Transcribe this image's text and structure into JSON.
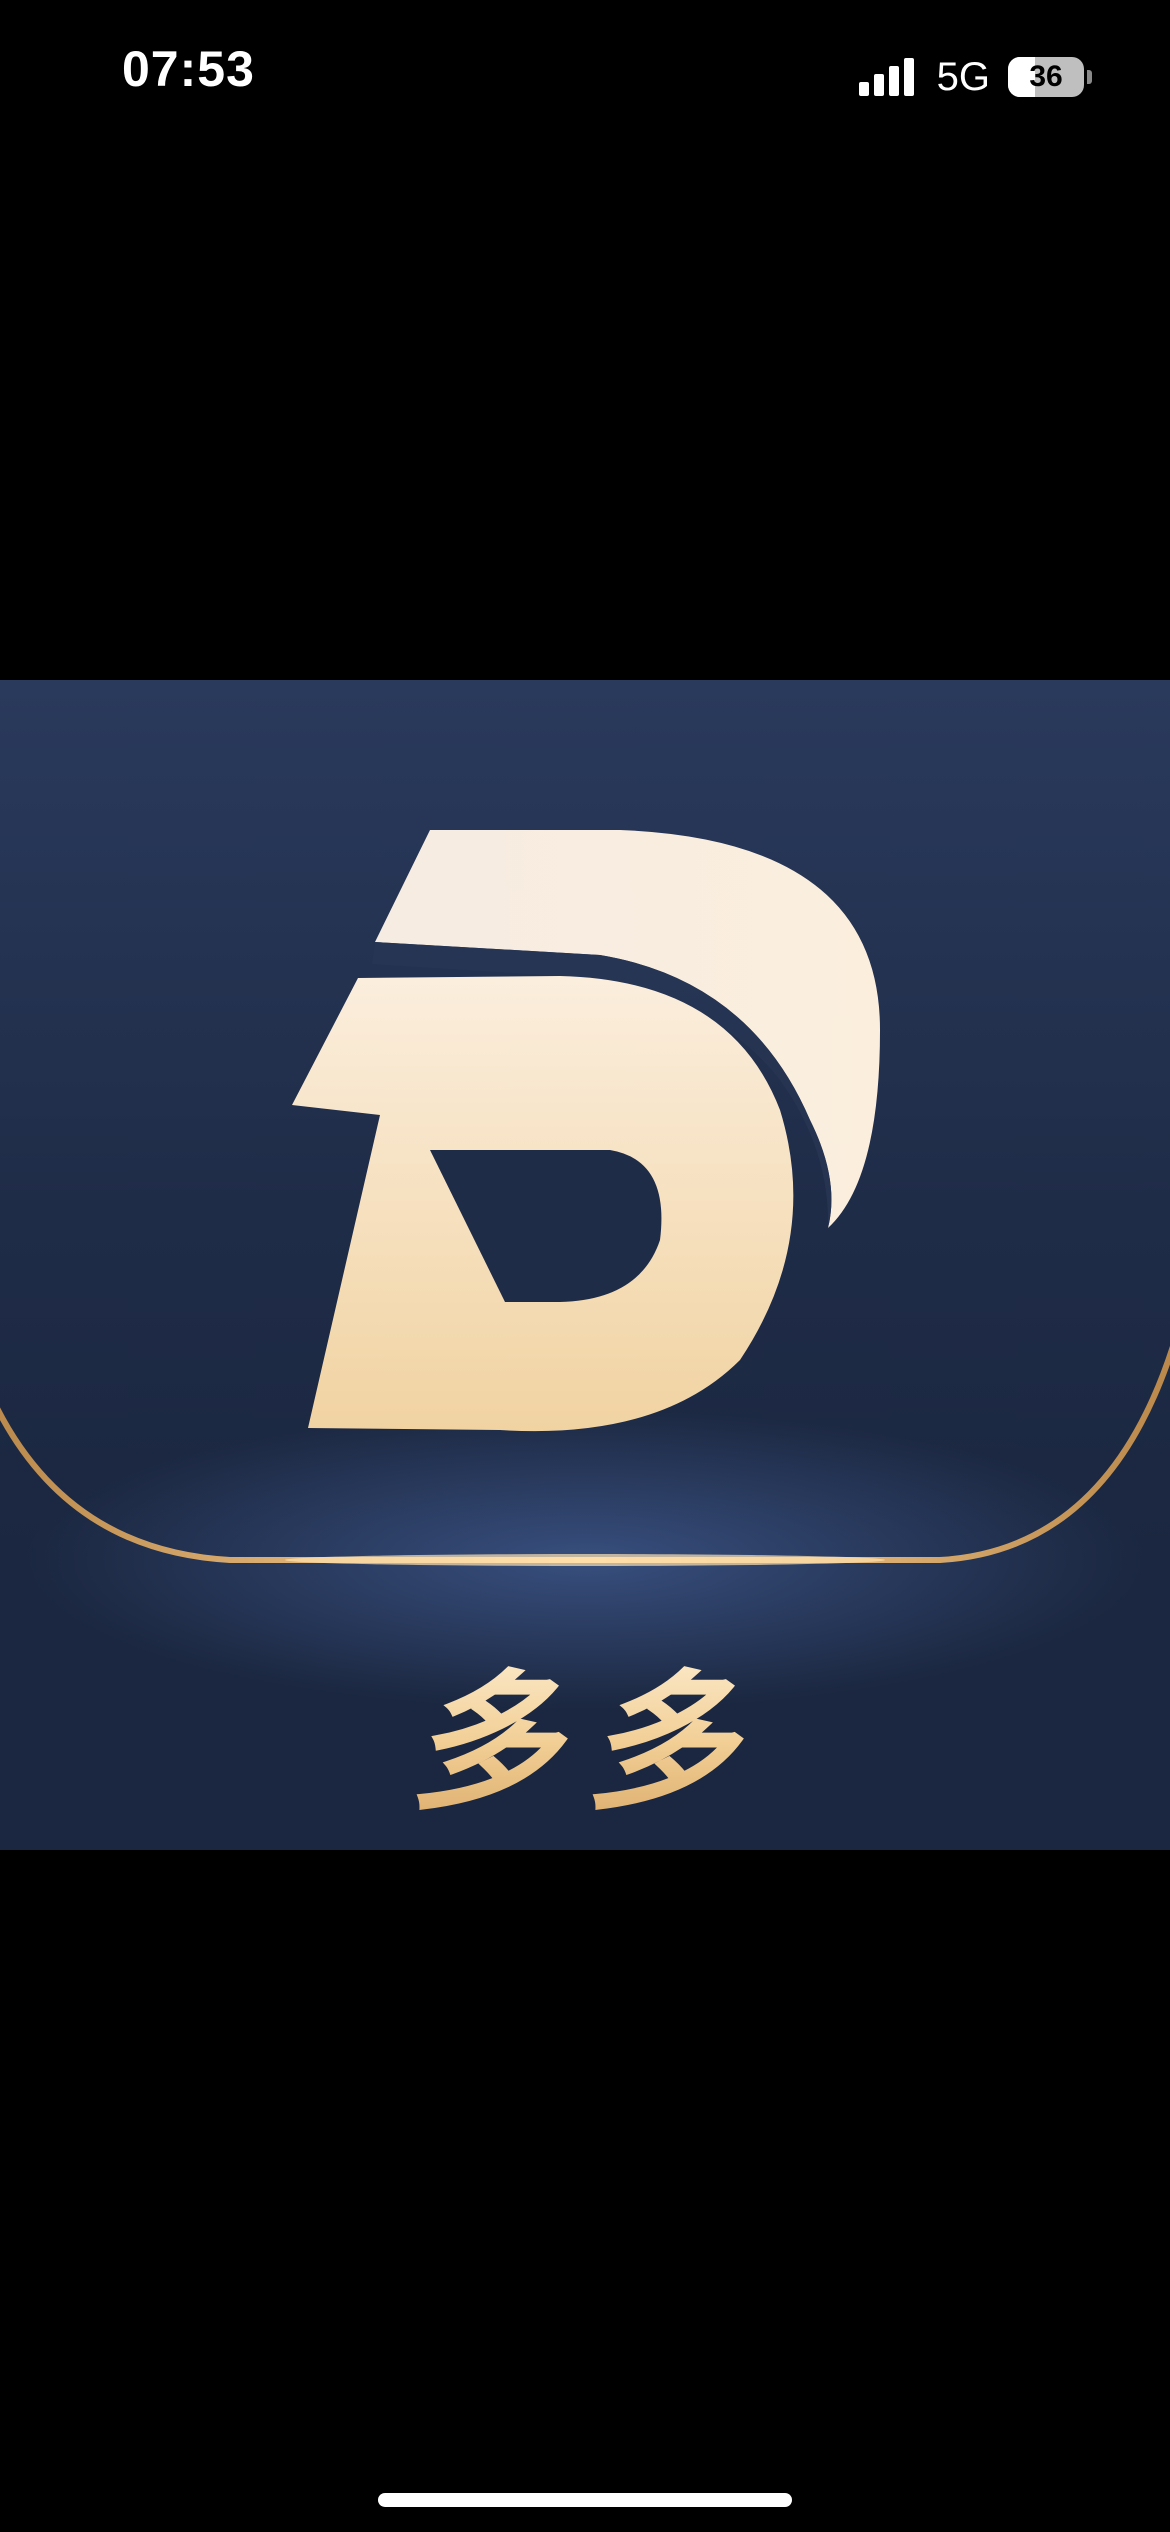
{
  "status_bar": {
    "time": "07:53",
    "signal_icon": "cellular-signal-icon",
    "signal_bars": 4,
    "network": "5G",
    "battery_icon": "battery-icon",
    "battery_level": "36",
    "battery_fraction": 0.36
  },
  "logo": {
    "letter_mark": "D",
    "caption": "多多",
    "colors": {
      "background_top": "#2a3a5c",
      "background_bottom": "#1b2740",
      "mark_light": "#fbeedd",
      "mark_gold": "#f1d3a2",
      "frame_gold": "#e2a75a"
    }
  },
  "home_indicator": {
    "icon": "home-indicator-bar"
  }
}
